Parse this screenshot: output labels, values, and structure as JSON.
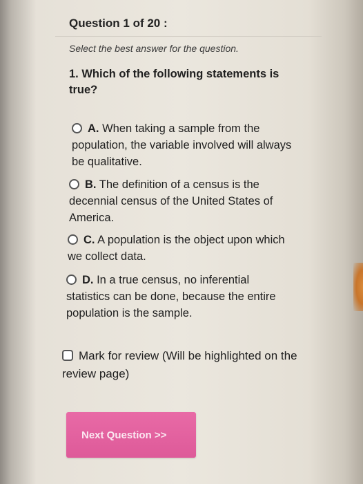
{
  "header": {
    "question_counter": "Question 1 of 20 :"
  },
  "instruction": "Select the best answer for the question.",
  "question": {
    "text": "1. Which of the following statements is true?"
  },
  "options": [
    {
      "letter": "A.",
      "text": " When taking a sample from the population, the variable involved will always be qualitative."
    },
    {
      "letter": "B.",
      "text": " The definition of a census is the decennial census of the United States of America."
    },
    {
      "letter": "C.",
      "text": " A population is the object upon which we collect data."
    },
    {
      "letter": "D.",
      "text": " In a true census, no inferential statistics can be done, because the entire population is the sample."
    }
  ],
  "review": {
    "label": "Mark for review (Will be highlighted on the review page)"
  },
  "next_button": {
    "label": "Next Question >>"
  },
  "colors": {
    "accent": "#e063a0"
  }
}
